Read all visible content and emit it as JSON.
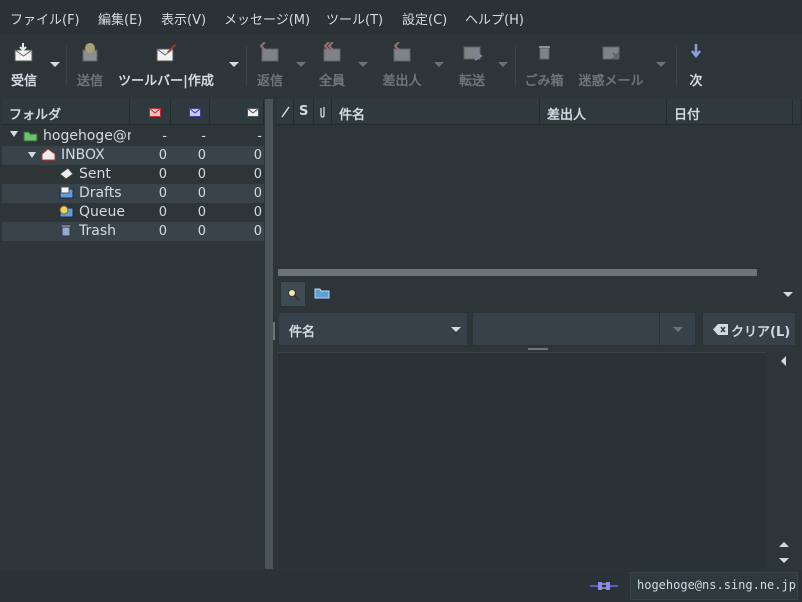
{
  "menubar": {
    "items": [
      "ファイル(F)",
      "編集(E)",
      "表示(V)",
      "メッセージ(M)",
      "ツール(T)",
      "設定(C)",
      "ヘルプ(H)"
    ]
  },
  "toolbar": {
    "receive": "受信",
    "send": "送信",
    "compose": "ツールバー|作成",
    "reply": "返信",
    "reply_all": "全員",
    "reply_sender": "差出人",
    "forward": "転送",
    "trash": "ごみ箱",
    "junk": "迷惑メール",
    "next": "次"
  },
  "folder_pane": {
    "header": "フォルダ",
    "account": {
      "name": "hogehoge@ns",
      "counts": [
        "-",
        "-",
        "-"
      ]
    },
    "folders": [
      {
        "name": "INBOX",
        "counts": [
          "0",
          "0",
          "0"
        ]
      },
      {
        "name": "Sent",
        "counts": [
          "0",
          "0",
          "0"
        ]
      },
      {
        "name": "Drafts",
        "counts": [
          "0",
          "0",
          "0"
        ]
      },
      {
        "name": "Queue",
        "counts": [
          "0",
          "0",
          "0"
        ]
      },
      {
        "name": "Trash",
        "counts": [
          "0",
          "0",
          "0"
        ]
      }
    ]
  },
  "summary": {
    "columns": {
      "status": "S",
      "subject": "件名",
      "from": "差出人",
      "date": "日付"
    }
  },
  "filter": {
    "field": "件名",
    "value": "",
    "clear_label": "クリア(L)"
  },
  "statusbar": {
    "account": "hogehoge@ns.sing.ne.jp"
  },
  "colors": {
    "background": "#2d3538",
    "text": "#d3dae3",
    "accent": "#5aa0d6"
  }
}
